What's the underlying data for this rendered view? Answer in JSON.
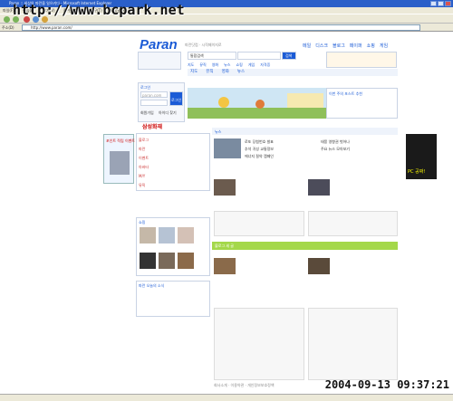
{
  "browser": {
    "title": "Paran :: 세상의 파란을 일으키다 - Microsoft Internet Explorer",
    "menu": [
      "파일(F)",
      "편집(E)",
      "보기(V)",
      "즐겨찾기(A)",
      "도구(T)",
      "도움말(H)"
    ],
    "address_label": "주소(D)",
    "address_value": "http://www.paran.com/"
  },
  "watermark": "http://www.bcpark.net",
  "date_stamp": "2004-09-13 09:37:21",
  "site": {
    "logo": "Paran",
    "logo_sub": "파란닷컴 · 시작페이지로",
    "topnav": [
      "메일",
      "디스크",
      "블로그",
      "페이퍼",
      "쇼핑",
      "게임"
    ],
    "search": {
      "select": "통합검색",
      "button": "검색"
    },
    "categories": [
      "지도",
      "뮤직",
      "영화",
      "뉴스",
      "쇼핑",
      "게임",
      "자격증"
    ],
    "login": {
      "title": "로그인",
      "placeholder": "paran.com",
      "button": "로그인",
      "links": [
        "회원가입",
        "아이디 찾기"
      ]
    },
    "samsung": "삼성화재",
    "left_items": [
      "블로그",
      "파란",
      "이벤트",
      "아바타",
      "M/Y",
      "뮤직"
    ],
    "mall_title": "쇼핑",
    "news_tab": "뉴스",
    "news_items": [
      "로또 당첨번호 발표",
      "추석 귀성 교통정보",
      "에너지 절약 캠페인",
      "태풍 영향권 벗어나",
      "주요 뉴스 모아보기"
    ],
    "promo": "이번 주의 포스트 추천",
    "green_bar": "블로그 새 글",
    "bottom_left": "파란 오늘의 소식",
    "ad_left": "포인트 적립 이벤트",
    "ad_right": "PC 공짜!",
    "footer": "회사소개 · 이용약관 · 개인정보보호정책"
  },
  "colors": {
    "brand": "#1b5bd6",
    "green": "#a4d84a",
    "titlebar": "#2a5fc9"
  }
}
